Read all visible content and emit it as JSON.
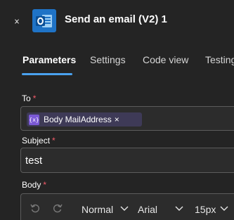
{
  "header": {
    "title": "Send an email (V2) 1",
    "collapse_icon": "double-chevron-right-icon",
    "app_icon": "outlook-icon"
  },
  "tabs": [
    {
      "label": "Parameters",
      "active": true
    },
    {
      "label": "Settings"
    },
    {
      "label": "Code view"
    },
    {
      "label": "Testing"
    }
  ],
  "fields": {
    "to": {
      "label": "To",
      "required": "*",
      "token": {
        "icon": "expression-icon",
        "icon_text": "{x}",
        "text": "Body MailAddress",
        "remove": "×"
      }
    },
    "subject": {
      "label": "Subject",
      "required": "*",
      "value": "test"
    },
    "body": {
      "label": "Body",
      "required": "*"
    }
  },
  "body_toolbar": {
    "undo_icon": "undo-icon",
    "redo_icon": "redo-icon",
    "style": "Normal",
    "font": "Arial",
    "size": "15px"
  },
  "colors": {
    "background": "#242424",
    "accent": "#4aa2ef",
    "required": "#f45b69",
    "token_icon": "#7b59d6"
  }
}
